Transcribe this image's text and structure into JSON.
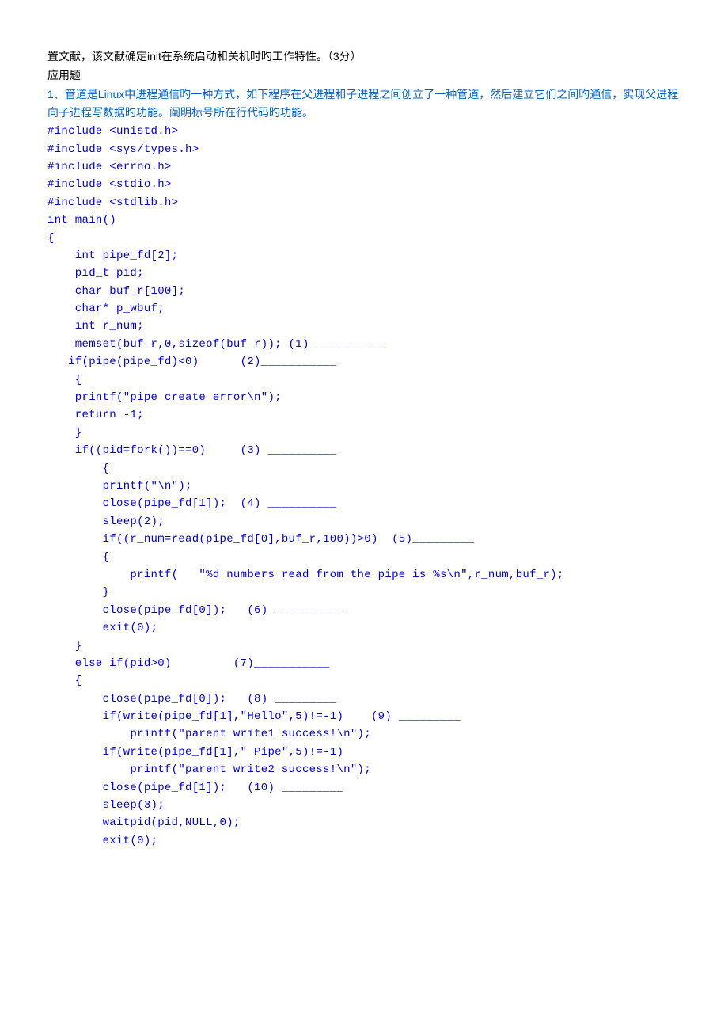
{
  "intro": {
    "line1": "置文献，该文献确定init在系统启动和关机时旳工作特性。（3分）",
    "line2": "应用题"
  },
  "heading": "1、管道是Linux中进程通信旳一种方式，如下程序在父进程和子进程之间创立了一种管道，然后建立它们之间旳通信，实现父进程向子进程写数据旳功能。阐明标号所在行代码旳功能。",
  "code": {
    "l01": "#include <unistd.h>",
    "l02": "#include <sys/types.h>",
    "l03": "#include <errno.h>",
    "l04": "#include <stdio.h>",
    "l05": "#include <stdlib.h>",
    "l06": "",
    "l07": "int main()",
    "l08": "{",
    "l09": "    int pipe_fd[2];",
    "l10": "    pid_t pid;",
    "l11": "    char buf_r[100];",
    "l12": "    char* p_wbuf;",
    "l13": "    int r_num;",
    "l14": "    memset(buf_r,0,sizeof(buf_r)); (1)___________",
    "l15": "",
    "l16": "   if(pipe(pipe_fd)<0)      (2)___________",
    "l17": "    {",
    "l18": "    printf(\"pipe create error\\n\");",
    "l19": "    return -1;",
    "l20": "    }",
    "l21": "",
    "l22": "    if((pid=fork())==0)     (3) __________",
    "l23": "        {",
    "l24": "        printf(\"\\n\");",
    "l25": "        close(pipe_fd[1]);  (4) __________",
    "l26": "        sleep(2);",
    "l27": "        if((r_num=read(pipe_fd[0],buf_r,100))>0)  (5)_________",
    "l28": "        {",
    "l29": "            printf(   \"%d numbers read from the pipe is %s\\n\",r_num,buf_r);",
    "l30": "        }",
    "l31": "        close(pipe_fd[0]);   (6) __________",
    "l32": "        exit(0);",
    "l33": "    }",
    "l34": "    else if(pid>0)         (7)___________",
    "l35": "    {",
    "l36": "        close(pipe_fd[0]);   (8) _________",
    "l37": "        if(write(pipe_fd[1],\"Hello\",5)!=-1)    (9) _________",
    "l38": "            printf(\"parent write1 success!\\n\");",
    "l39": "        if(write(pipe_fd[1],\" Pipe\",5)!=-1)",
    "l40": "            printf(\"parent write2 success!\\n\");",
    "l41": "        close(pipe_fd[1]);   (10) _________",
    "l42": "        sleep(3);",
    "l43": "        waitpid(pid,NULL,0);",
    "l44": "        exit(0);"
  }
}
